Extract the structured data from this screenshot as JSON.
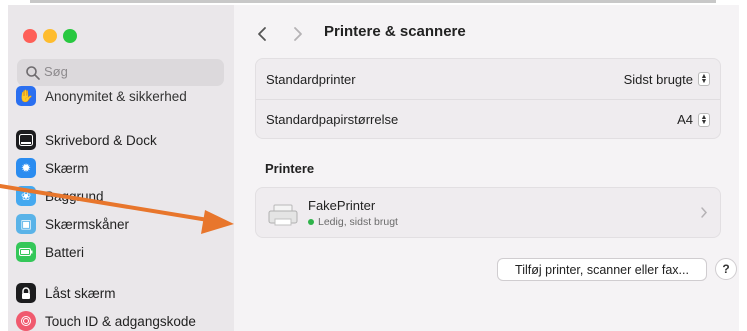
{
  "sidebar": {
    "search_placeholder": "Søg",
    "clipped_item": "Anonymitet & sikkerhed",
    "items": [
      {
        "label": "Skrivebord & Dock",
        "icon": "dock-icon",
        "color": "#1c1c1e"
      },
      {
        "label": "Skærm",
        "icon": "sun-icon",
        "color": "#2a8cf0"
      },
      {
        "label": "Baggrund",
        "icon": "flower-icon",
        "color": "#45a9f0"
      },
      {
        "label": "Skærmskåner",
        "icon": "screensaver-icon",
        "color": "#5ab3e8"
      },
      {
        "label": "Batteri",
        "icon": "battery-icon",
        "color": "#34c759"
      },
      {
        "label": "Låst skærm",
        "icon": "lock-icon",
        "color": "#1c1c1e"
      },
      {
        "label": "Touch ID & adgangskode",
        "icon": "fingerprint-icon",
        "color": "#f05a6e"
      }
    ]
  },
  "header": {
    "title": "Printere & scannere"
  },
  "settings": {
    "default_printer_label": "Standardprinter",
    "default_printer_value": "Sidst brugte",
    "paper_size_label": "Standardpapirstørrelse",
    "paper_size_value": "A4"
  },
  "printers": {
    "section_title": "Printere",
    "list": [
      {
        "name": "FakePrinter",
        "status": "Ledig, sidst brugt"
      }
    ]
  },
  "actions": {
    "add_label": "Tilføj printer, scanner eller fax...",
    "help_label": "?"
  },
  "colors": {
    "annotation_arrow": "#e8762c"
  }
}
